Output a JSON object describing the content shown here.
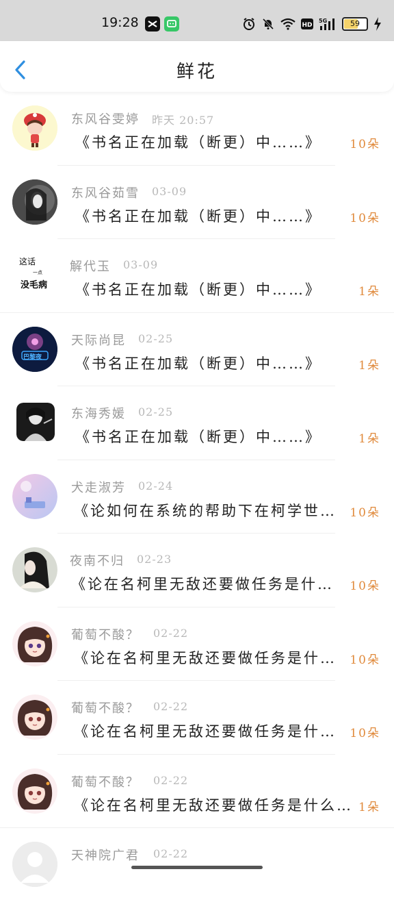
{
  "status_bar": {
    "time": "19:28",
    "battery": "59",
    "network": "5G"
  },
  "header": {
    "title": "鲜花"
  },
  "items": [
    {
      "name": "东风谷雯婷",
      "date": "昨天 20:57",
      "book": "《书名正在加载（断更）中……》",
      "count": "10朵"
    },
    {
      "name": "东风谷茹雪",
      "date": "03-09",
      "book": "《书名正在加载（断更）中……》",
      "count": "10朵"
    },
    {
      "name": "解代玉",
      "date": "03-09",
      "book": "《书名正在加载（断更）中……》",
      "count": "1朵"
    },
    {
      "name": "天际尚昆",
      "date": "02-25",
      "book": "《书名正在加载（断更）中……》",
      "count": "1朵"
    },
    {
      "name": "东海秀媛",
      "date": "02-25",
      "book": "《书名正在加载（断更）中……》",
      "count": "1朵"
    },
    {
      "name": "犬走淑芳",
      "date": "02-24",
      "book": "《论如何在系统的帮助下在柯学世…",
      "count": "10朵"
    },
    {
      "name": "夜南不归",
      "date": "02-23",
      "book": "《论在名柯里无敌还要做任务是什…",
      "count": "10朵"
    },
    {
      "name": "葡萄不酸？",
      "date": "02-22",
      "book": "《论在名柯里无敌还要做任务是什…",
      "count": "10朵"
    },
    {
      "name": "葡萄不酸？",
      "date": "02-22",
      "book": "《论在名柯里无敌还要做任务是什…",
      "count": "10朵"
    },
    {
      "name": "葡萄不酸？",
      "date": "02-22",
      "book": "《论在名柯里无敌还要做任务是什么…",
      "count": "1朵"
    },
    {
      "name": "天神院广君",
      "date": "02-22",
      "book": "",
      "count": ""
    }
  ],
  "avatar_texts": {
    "item3_line1": "这话",
    "item3_line2": "一点",
    "item3_line3": "没毛病",
    "item4_badge": "巴黎夜"
  },
  "colors": {
    "accent": "#2f8fe0",
    "count": "#e08a3c"
  }
}
